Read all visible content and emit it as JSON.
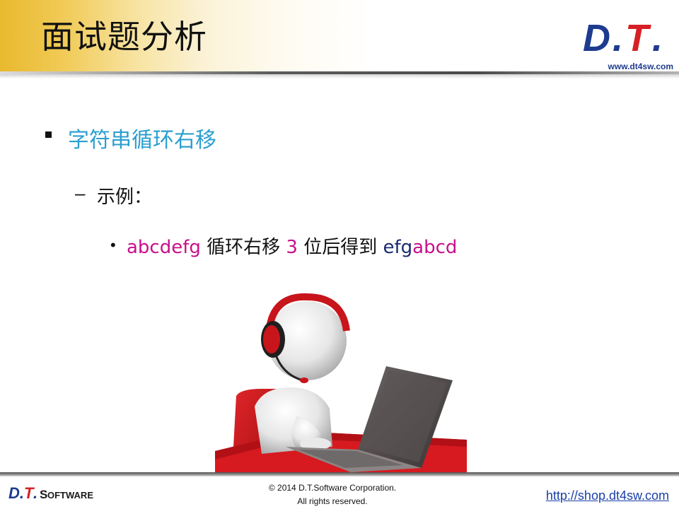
{
  "header": {
    "title": "面试题分析",
    "logo_text": "D.T.",
    "logo_url": "www.dt4sw.com"
  },
  "content": {
    "level1": "字符串循环右移",
    "level2_dash": "–",
    "level2": "示例：",
    "level3_dot": "•",
    "example": {
      "original": "abcdefg",
      "phrase1": " 循环右移 ",
      "count": "3",
      "phrase2": " 位后得到 ",
      "result_part1": "efg",
      "result_part2": "abcd"
    }
  },
  "illustration": {
    "icon": "person-with-headset-at-laptop-icon"
  },
  "footer": {
    "logo_text": "D.T.",
    "logo_software": "SOFTWARE",
    "copyright_line1": "© 2014 D.T.Software Corporation.",
    "copyright_line2": "All rights reserved.",
    "shop_link": "http://shop.dt4sw.com"
  },
  "colors": {
    "heading_blue": "#2b9fcf",
    "magenta": "#c8108a",
    "navy": "#1a2a6e",
    "logo_blue": "#1d3b8f",
    "logo_red": "#d81f26",
    "header_gold": "#e9b92e"
  }
}
